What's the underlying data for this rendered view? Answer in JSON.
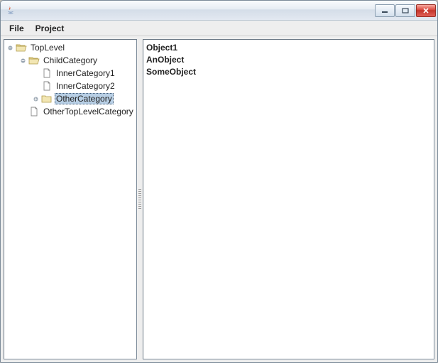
{
  "window": {
    "title": ""
  },
  "menubar": {
    "items": [
      "File",
      "Project"
    ]
  },
  "tree": {
    "nodes": [
      {
        "label": "TopLevel",
        "depth": 0,
        "icon": "folder-open",
        "toggle": "open"
      },
      {
        "label": "ChildCategory",
        "depth": 1,
        "icon": "folder-open",
        "toggle": "open"
      },
      {
        "label": "InnerCategory1",
        "depth": 2,
        "icon": "file",
        "toggle": "none"
      },
      {
        "label": "InnerCategory2",
        "depth": 2,
        "icon": "file",
        "toggle": "none"
      },
      {
        "label": "OtherCategory",
        "depth": 2,
        "icon": "folder-closed",
        "toggle": "closed",
        "selected": true
      },
      {
        "label": "OtherTopLevelCategory",
        "depth": 1,
        "icon": "file",
        "toggle": "none"
      }
    ]
  },
  "list": {
    "items": [
      "Object1",
      "AnObject",
      "SomeObject"
    ]
  }
}
